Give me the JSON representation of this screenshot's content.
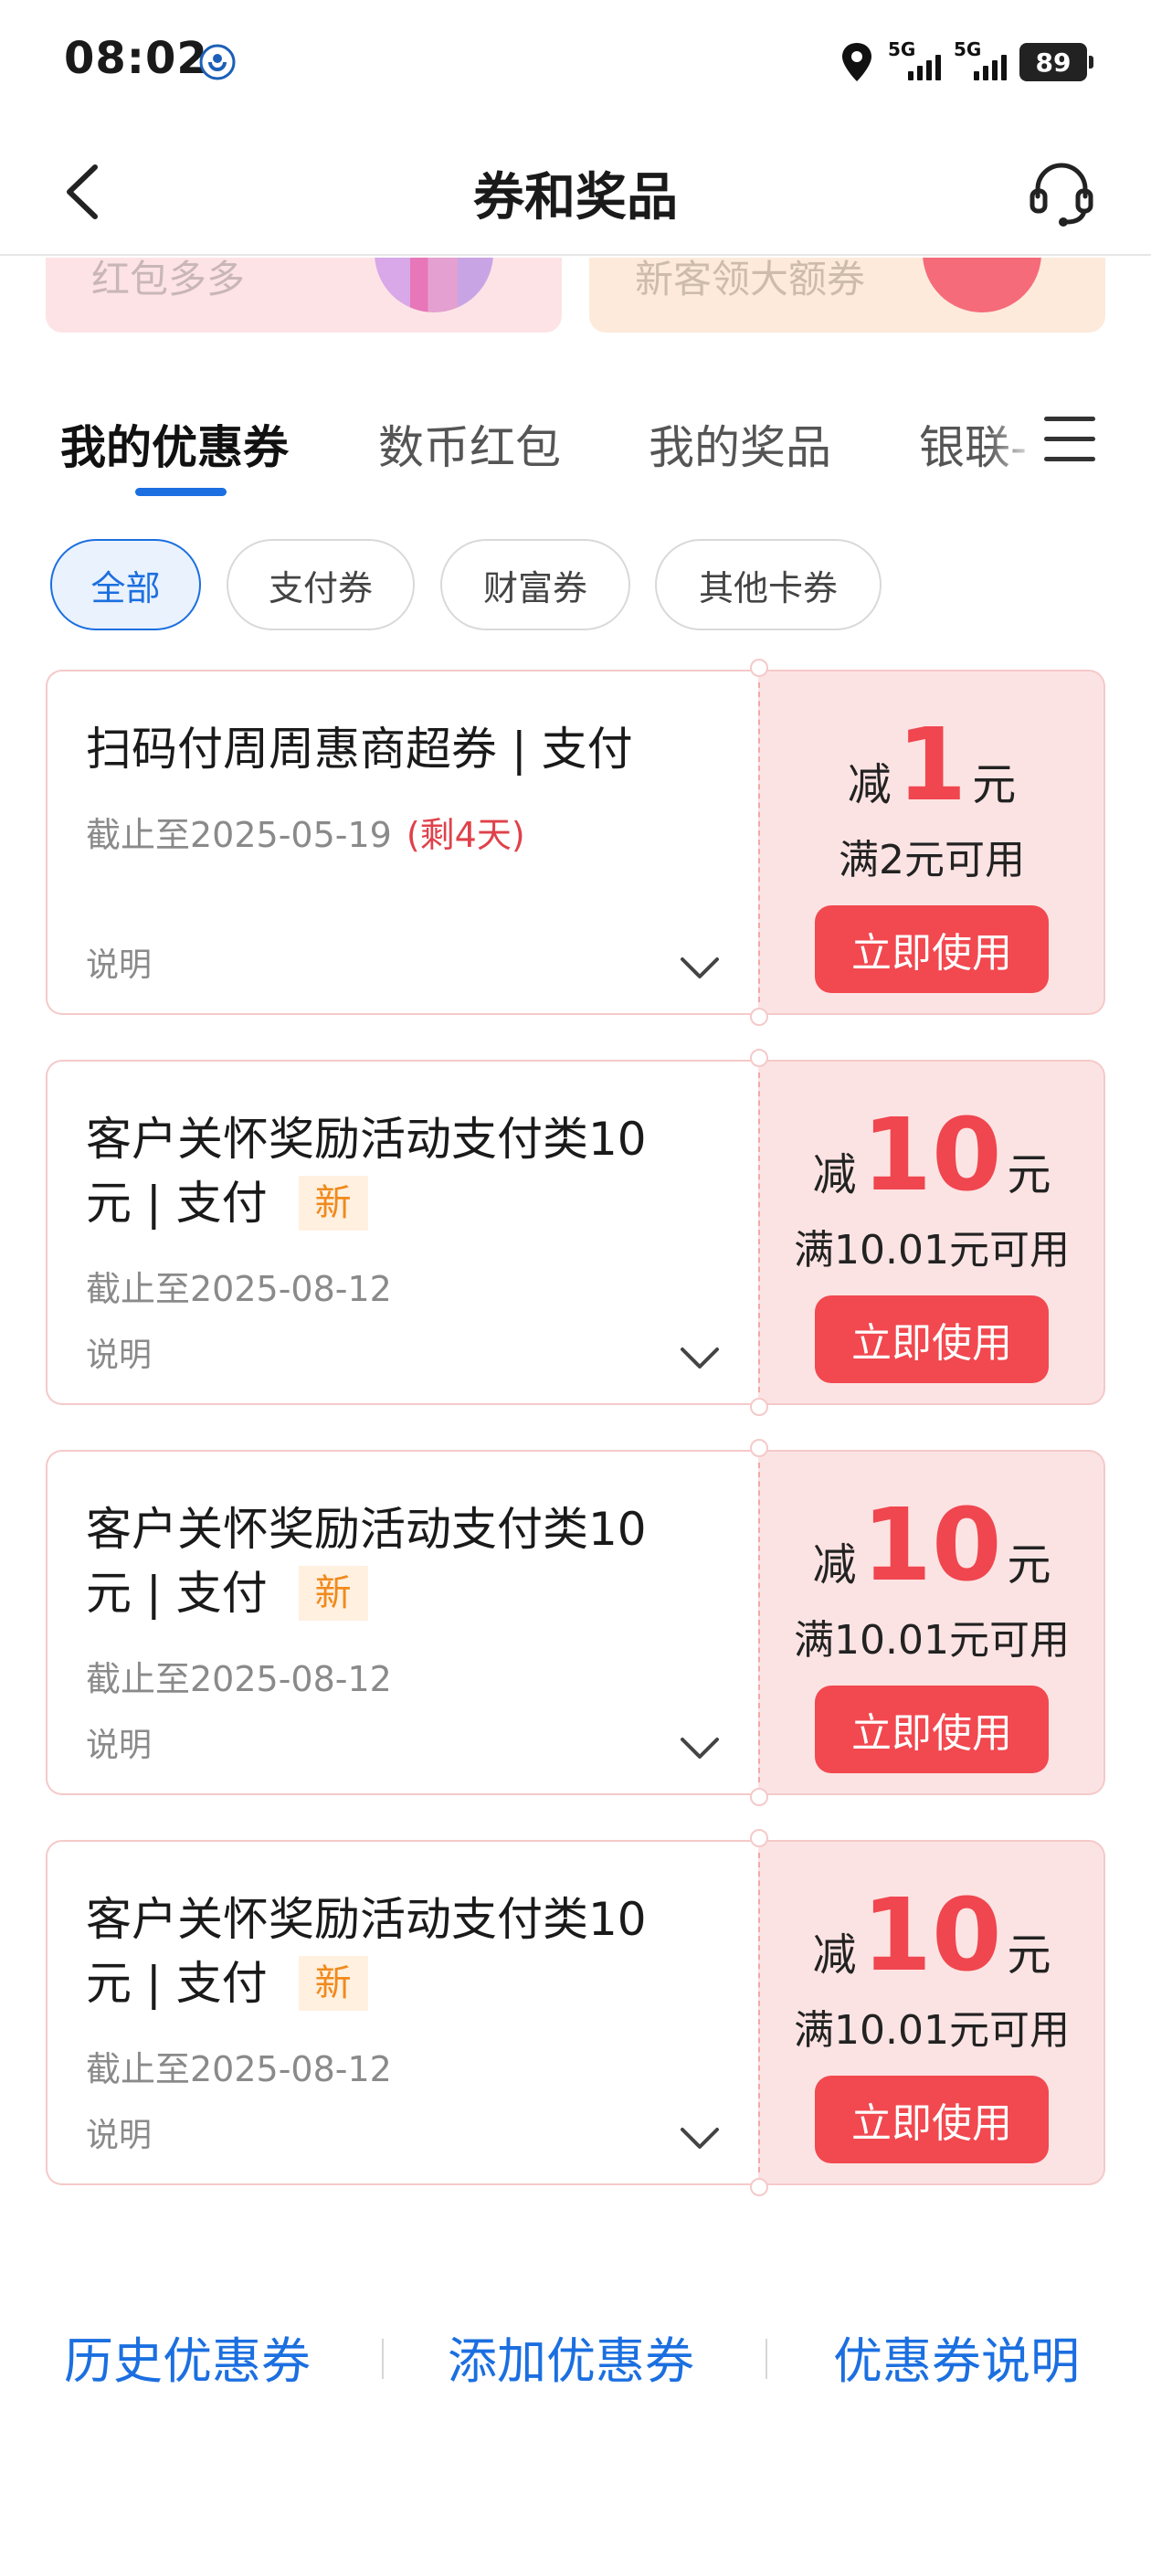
{
  "status_bar": {
    "time": "08:02",
    "app_icon": "bank-app-icon",
    "signal_1": "5G",
    "signal_2": "5G",
    "battery": "89"
  },
  "navbar": {
    "title": "券和奖品",
    "back_icon": "chevron-left-icon",
    "service_icon": "headset-icon"
  },
  "banners": [
    {
      "partial_text": "红包多多"
    },
    {
      "partial_text": "新客领大额券"
    }
  ],
  "tabs": [
    {
      "label": "我的优惠券",
      "active": true
    },
    {
      "label": "数币红包",
      "active": false
    },
    {
      "label": "我的奖品",
      "active": false
    },
    {
      "label": "银联-",
      "active": false
    }
  ],
  "tabs_menu_icon": "menu-icon",
  "filters": [
    {
      "label": "全部",
      "active": true
    },
    {
      "label": "支付券",
      "active": false
    },
    {
      "label": "财富券",
      "active": false
    },
    {
      "label": "其他卡券",
      "active": false
    }
  ],
  "coupons": [
    {
      "title": "扫码付周周惠商超券 | 支付",
      "badge": "",
      "expiry": "截止至2025-05-19",
      "remaining": "(剩4天)",
      "desc": "说明",
      "prefix": "减",
      "amount": "1",
      "unit": "元",
      "condition": "满2元可用",
      "button": "立即使用"
    },
    {
      "title_line1": "客户关怀奖励活动支付类10",
      "title_line2": "元 | 支付",
      "badge": "新",
      "expiry": "截止至2025-08-12",
      "desc": "说明",
      "prefix": "减",
      "amount": "10",
      "unit": "元",
      "condition": "满10.01元可用",
      "button": "立即使用"
    },
    {
      "title_line1": "客户关怀奖励活动支付类10",
      "title_line2": "元 | 支付",
      "badge": "新",
      "expiry": "截止至2025-08-12",
      "desc": "说明",
      "prefix": "减",
      "amount": "10",
      "unit": "元",
      "condition": "满10.01元可用",
      "button": "立即使用"
    },
    {
      "title_line1": "客户关怀奖励活动支付类10",
      "title_line2": "元 | 支付",
      "badge": "新",
      "expiry": "截止至2025-08-12",
      "desc": "说明",
      "prefix": "减",
      "amount": "10",
      "unit": "元",
      "condition": "满10.01元可用",
      "button": "立即使用"
    }
  ],
  "bottom_links": [
    {
      "label": "历史优惠券"
    },
    {
      "label": "添加优惠券"
    },
    {
      "label": "优惠券说明"
    }
  ],
  "colors": {
    "accent_blue": "#1b6fe0",
    "coupon_red": "#f2484f",
    "coupon_bg": "#fce3e3",
    "new_badge": "#f08a1c"
  }
}
